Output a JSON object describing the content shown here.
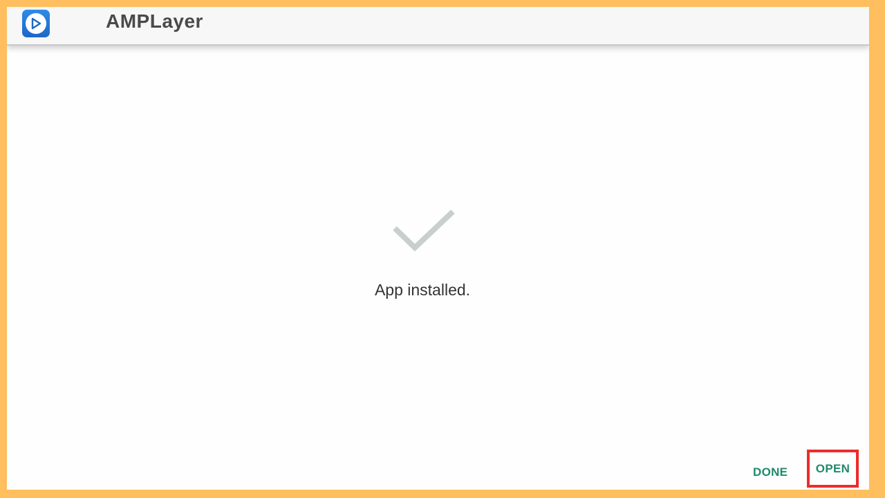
{
  "header": {
    "app_title": "AMPLayer",
    "app_icon": "play-icon"
  },
  "main": {
    "status_icon": "checkmark-icon",
    "status_text": "App installed."
  },
  "actions": {
    "done_label": "DONE",
    "open_label": "OPEN"
  },
  "colors": {
    "frame": "#ffbf5e",
    "accent": "#1f8a6a",
    "highlight": "#f02a2a",
    "checkmark": "#c9cfcd",
    "icon_bg": "#1d67c8"
  }
}
